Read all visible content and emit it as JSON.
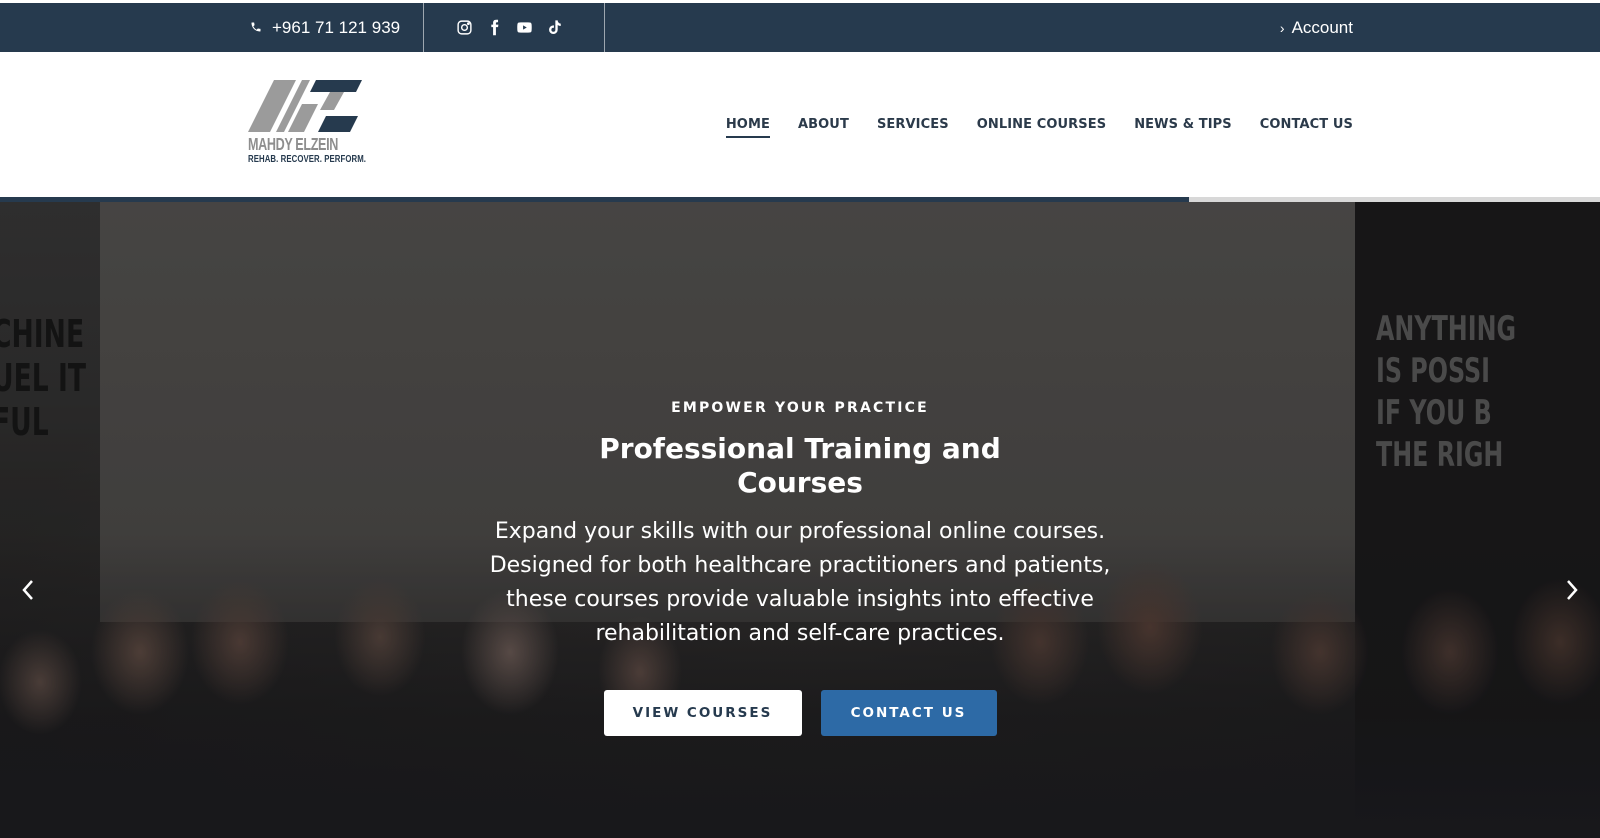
{
  "topbar": {
    "phone": "+961 71 121 939",
    "social_icons": [
      "instagram-icon",
      "facebook-icon",
      "youtube-icon",
      "tiktok-icon"
    ],
    "account_label": "Account"
  },
  "logo": {
    "brand": "MAHDY ELZEIN",
    "tagline": "REHAB. RECOVER. PERFORM."
  },
  "nav": {
    "items": [
      "HOME",
      "ABOUT",
      "SERVICES",
      "ONLINE COURSES",
      "NEWS & TIPS",
      "CONTACT US"
    ],
    "active": "HOME"
  },
  "slider": {
    "progress": 0.743
  },
  "hero": {
    "eyebrow": "EMPOWER YOUR PRACTICE",
    "title_line1": "Professional Training and",
    "title_line2": "Courses",
    "description": "Expand your skills with our professional online courses. Designed for both healthcare practitioners and patients, these courses provide valuable insights into effective rehabilitation and self-care practices.",
    "primary_button": "VIEW COURSES",
    "secondary_button": "CONTACT US",
    "photo_text_left": "CHINE\nUEL IT\nFUL",
    "photo_text_right": "ANYTHING\nIS POSSI\nIF YOU B\nTHE RIGH"
  },
  "colors": {
    "topbar": "#263a4e",
    "accent_button": "#2d6aa6",
    "nav_text": "#2b3a4a"
  }
}
